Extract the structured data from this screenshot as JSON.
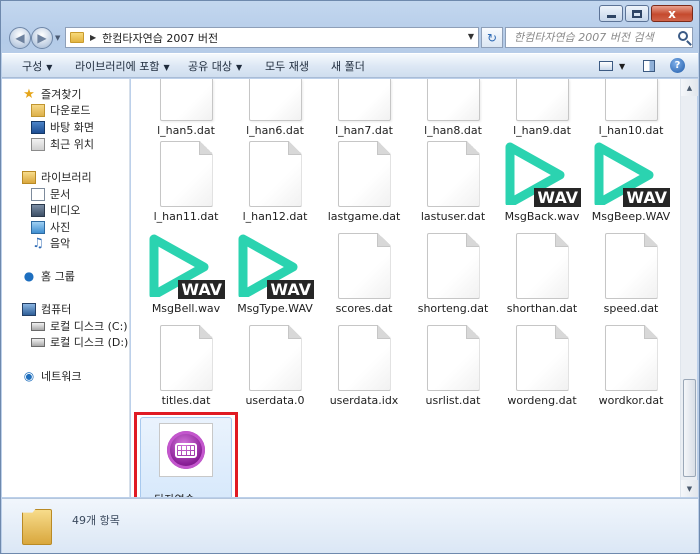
{
  "window": {
    "caption": {
      "minimize": "",
      "maximize": "",
      "close": "x"
    }
  },
  "address": {
    "path": "한컴타자연습 2007 버전"
  },
  "search": {
    "placeholder": "한컴타자연습 2007 버전 검색"
  },
  "toolbar": {
    "organize": "구성",
    "include_library": "라이브러리에 포함",
    "share": "공유 대상",
    "play_all": "모두 재생",
    "new_folder": "새 폴더"
  },
  "sidebar": {
    "favorites": "즐겨찾기",
    "downloads": "다운로드",
    "desktop": "바탕 화면",
    "recent": "최근 위치",
    "libraries": "라이브러리",
    "documents": "문서",
    "videos": "비디오",
    "pictures": "사진",
    "music": "음악",
    "homegroup": "홈 그룹",
    "computer": "컴퓨터",
    "disk_c": "로컬 디스크 (C:)",
    "disk_d": "로컬 디스크 (D:)",
    "network": "네트워크"
  },
  "files": [
    {
      "name": "l_han5.dat",
      "type": "dat"
    },
    {
      "name": "l_han6.dat",
      "type": "dat"
    },
    {
      "name": "l_han7.dat",
      "type": "dat"
    },
    {
      "name": "l_han8.dat",
      "type": "dat"
    },
    {
      "name": "l_han9.dat",
      "type": "dat"
    },
    {
      "name": "l_han10.dat",
      "type": "dat"
    },
    {
      "name": "l_han11.dat",
      "type": "dat"
    },
    {
      "name": "l_han12.dat",
      "type": "dat"
    },
    {
      "name": "lastgame.dat",
      "type": "dat"
    },
    {
      "name": "lastuser.dat",
      "type": "dat"
    },
    {
      "name": "MsgBack.wav",
      "type": "wav"
    },
    {
      "name": "MsgBeep.WAV",
      "type": "wav"
    },
    {
      "name": "MsgBell.wav",
      "type": "wav"
    },
    {
      "name": "MsgType.WAV",
      "type": "wav"
    },
    {
      "name": "scores.dat",
      "type": "dat"
    },
    {
      "name": "shorteng.dat",
      "type": "dat"
    },
    {
      "name": "shorthan.dat",
      "type": "dat"
    },
    {
      "name": "speed.dat",
      "type": "dat"
    },
    {
      "name": "titles.dat",
      "type": "dat"
    },
    {
      "name": "userdata.0",
      "type": "dat"
    },
    {
      "name": "userdata.idx",
      "type": "dat"
    },
    {
      "name": "usrlist.dat",
      "type": "dat"
    },
    {
      "name": "wordeng.dat",
      "type": "dat"
    },
    {
      "name": "wordkor.dat",
      "type": "dat"
    },
    {
      "name": "타자연습.exe",
      "type": "exe"
    }
  ],
  "wav_badge": "WAV",
  "wav_color": "#2bd3b0",
  "highlight_color": "#e01b24",
  "status": {
    "item_count": "49개 항목"
  }
}
